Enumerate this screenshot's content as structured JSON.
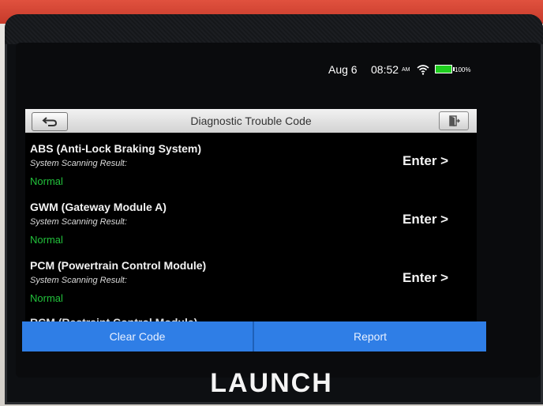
{
  "status_bar": {
    "date": "Aug 6",
    "time": "08:52",
    "ampm": "AM",
    "battery": "100%"
  },
  "header": {
    "title": "Diagnostic Trouble Code"
  },
  "modules": [
    {
      "name": "ABS (Anti-Lock Braking System)",
      "scan_label": "System Scanning Result:",
      "status": "Normal",
      "action": "Enter >"
    },
    {
      "name": "GWM (Gateway Module A)",
      "scan_label": "System Scanning Result:",
      "status": "Normal",
      "action": "Enter >"
    },
    {
      "name": "PCM (Powertrain Control Module)",
      "scan_label": "System Scanning Result:",
      "status": "Normal",
      "action": "Enter >"
    }
  ],
  "partial_module": {
    "name": "RCM (Restraint Control Module)"
  },
  "actions": {
    "clear_code": "Clear Code",
    "report": "Report"
  },
  "brand": {
    "logo_text": "LAUNCH"
  },
  "colors": {
    "status_normal": "#22c13b",
    "button_blue": "#2f7ee6",
    "battery_green": "#1fce1f"
  }
}
